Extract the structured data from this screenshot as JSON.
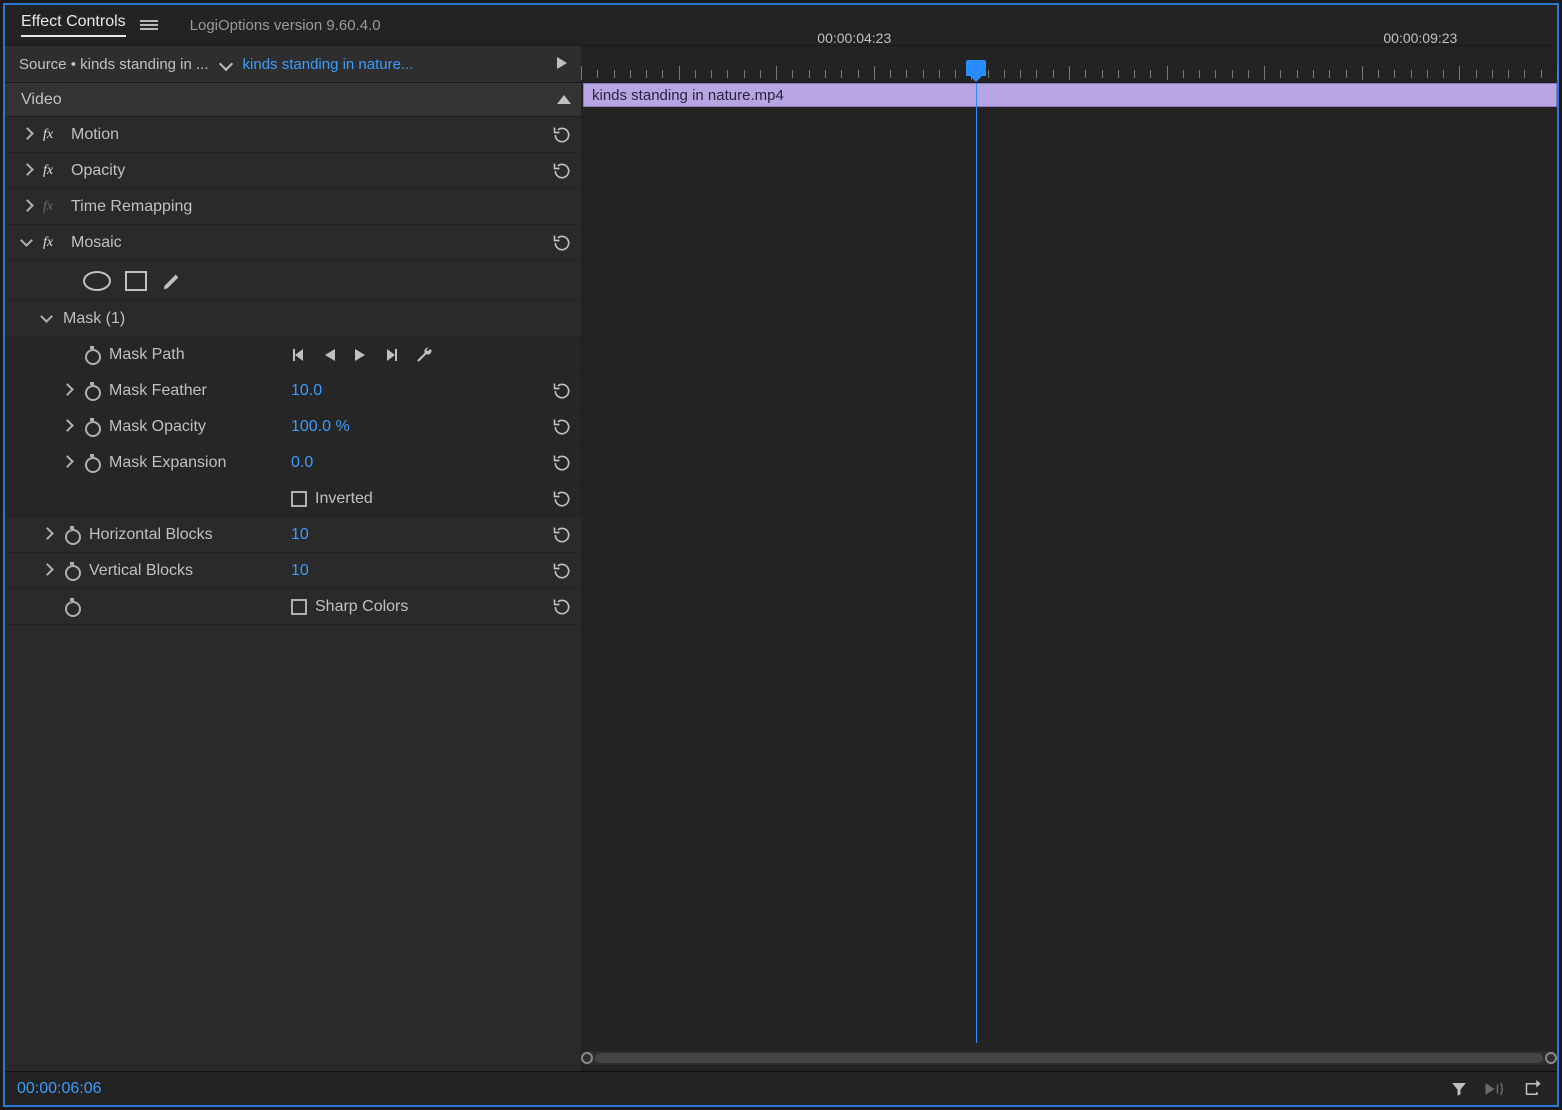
{
  "tabs": {
    "active": "Effect Controls",
    "other": "LogiOptions version 9.60.4.0"
  },
  "source": {
    "label": "Source • kinds standing in ...",
    "sequence": "kinds standing in nature..."
  },
  "timeline": {
    "clip_name": "kinds standing in nature.mp4",
    "tc_left": "00:00:04:23",
    "tc_right": "00:00:09:23",
    "playhead_pct": 40.5
  },
  "section": {
    "header": "Video"
  },
  "effects": {
    "motion": {
      "label": "Motion"
    },
    "opacity": {
      "label": "Opacity"
    },
    "timeremap": {
      "label": "Time Remapping"
    },
    "mosaic": {
      "label": "Mosaic",
      "mask": {
        "label": "Mask (1)",
        "path_label": "Mask Path",
        "feather": {
          "label": "Mask Feather",
          "value": "10.0"
        },
        "opacity": {
          "label": "Mask Opacity",
          "value": "100.0 %"
        },
        "expansion": {
          "label": "Mask Expansion",
          "value": "0.0"
        },
        "inverted_label": "Inverted"
      },
      "hblocks": {
        "label": "Horizontal Blocks",
        "value": "10"
      },
      "vblocks": {
        "label": "Vertical Blocks",
        "value": "10"
      },
      "sharp_label": "Sharp Colors"
    }
  },
  "footer": {
    "timecode": "00:00:06:06"
  }
}
